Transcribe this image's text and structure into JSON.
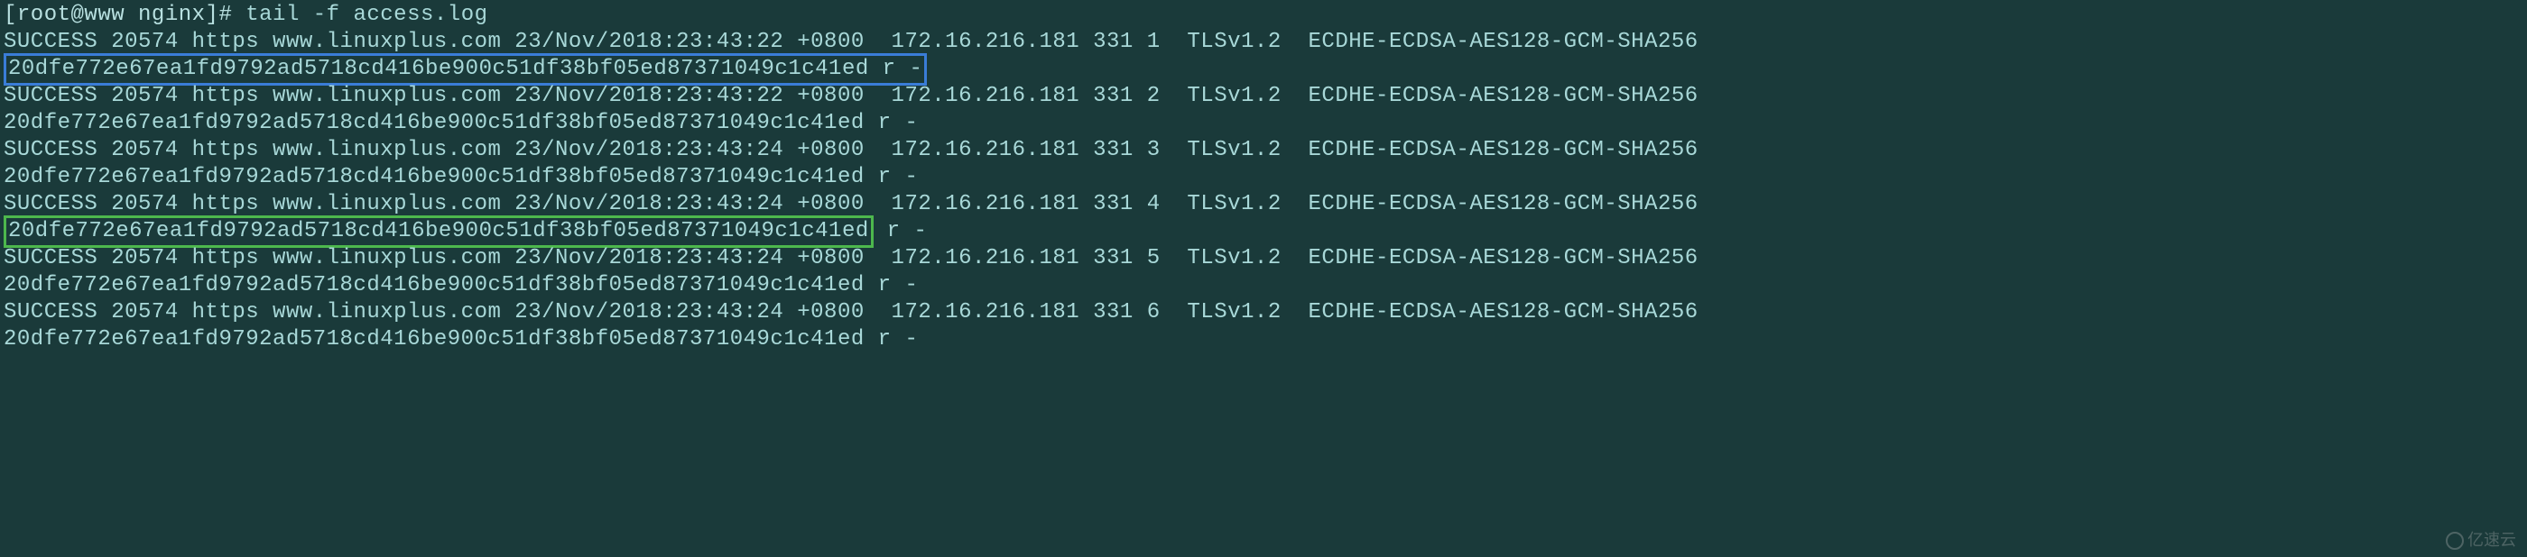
{
  "terminal": {
    "prompt": "[root@www nginx]# ",
    "command": "tail -f access.log",
    "log_entries": [
      {
        "line1": "SUCCESS 20574 https www.linuxplus.com 23/Nov/2018:23:43:22 +0800  172.16.216.181 331 1  TLSv1.2  ECDHE-ECDSA-AES128-GCM-SHA256",
        "line2_hash": "20dfe772e67ea1fd9792ad5718cd416be900c51df38bf05ed87371049c1c41ed r -",
        "highlight": "blue",
        "highlight_full_line2": true
      },
      {
        "line1": "SUCCESS 20574 https www.linuxplus.com 23/Nov/2018:23:43:22 +0800  172.16.216.181 331 2  TLSv1.2  ECDHE-ECDSA-AES128-GCM-SHA256",
        "line2_hash": "20dfe772e67ea1fd9792ad5718cd416be900c51df38bf05ed87371049c1c41ed",
        "line2_suffix": " r -",
        "highlight": "none"
      },
      {
        "line1": "SUCCESS 20574 https www.linuxplus.com 23/Nov/2018:23:43:24 +0800  172.16.216.181 331 3  TLSv1.2  ECDHE-ECDSA-AES128-GCM-SHA256",
        "line2_hash": "20dfe772e67ea1fd9792ad5718cd416be900c51df38bf05ed87371049c1c41ed",
        "line2_suffix": " r -",
        "highlight": "none"
      },
      {
        "line1": "SUCCESS 20574 https www.linuxplus.com 23/Nov/2018:23:43:24 +0800  172.16.216.181 331 4  TLSv1.2  ECDHE-ECDSA-AES128-GCM-SHA256",
        "line2_hash": "20dfe772e67ea1fd9792ad5718cd416be900c51df38bf05ed87371049c1c41ed",
        "line2_suffix": " r -",
        "highlight": "green"
      },
      {
        "line1": "SUCCESS 20574 https www.linuxplus.com 23/Nov/2018:23:43:24 +0800  172.16.216.181 331 5  TLSv1.2  ECDHE-ECDSA-AES128-GCM-SHA256",
        "line2_hash": "20dfe772e67ea1fd9792ad5718cd416be900c51df38bf05ed87371049c1c41ed",
        "line2_suffix": " r -",
        "highlight": "none"
      },
      {
        "line1": "SUCCESS 20574 https www.linuxplus.com 23/Nov/2018:23:43:24 +0800  172.16.216.181 331 6  TLSv1.2  ECDHE-ECDSA-AES128-GCM-SHA256",
        "line2_hash": "20dfe772e67ea1fd9792ad5718cd416be900c51df38bf05ed87371049c1c41ed",
        "line2_suffix": " r -",
        "highlight": "none"
      }
    ]
  },
  "watermark": {
    "text": "亿速云"
  }
}
